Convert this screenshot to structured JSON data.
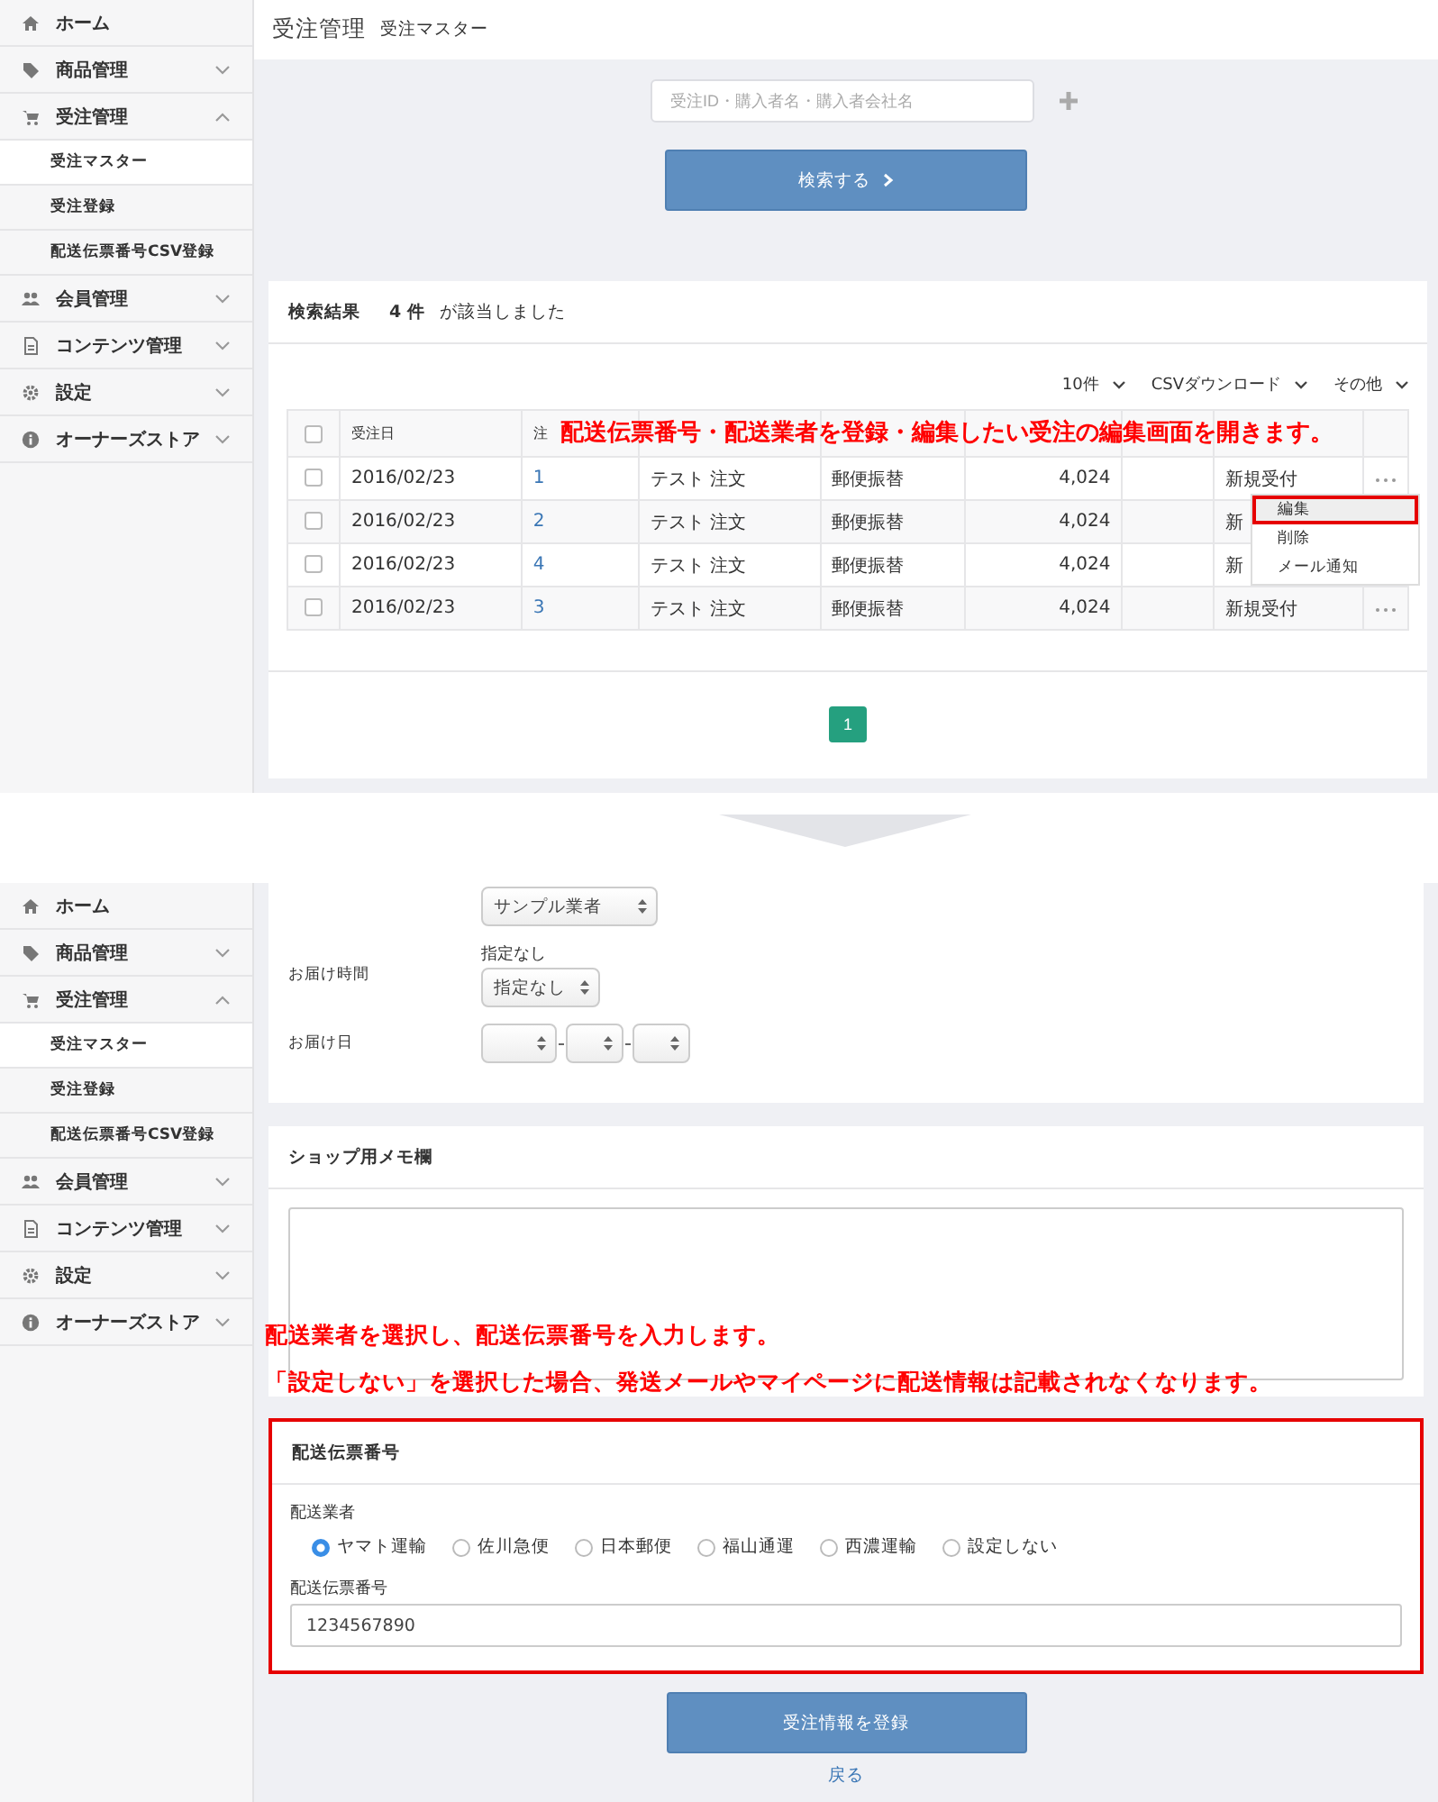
{
  "top": {
    "sidebar": [
      {
        "kind": "home",
        "label": "ホーム"
      },
      {
        "kind": "tag",
        "label": "商品管理",
        "expanded": false
      },
      {
        "kind": "cart",
        "label": "受注管理",
        "expanded": true,
        "children": [
          {
            "label": "受注マスター",
            "selected": true
          },
          {
            "label": "受注登録",
            "selected": false
          },
          {
            "label": "配送伝票番号CSV登録",
            "selected": false
          }
        ]
      },
      {
        "kind": "users",
        "label": "会員管理",
        "expanded": false
      },
      {
        "kind": "file",
        "label": "コンテンツ管理",
        "expanded": false
      },
      {
        "kind": "gear",
        "label": "設定",
        "expanded": false
      },
      {
        "kind": "info",
        "label": "オーナーズストア",
        "expanded": false
      }
    ],
    "header": {
      "title": "受注管理",
      "subtitle": "受注マスター"
    },
    "search": {
      "placeholder": "受注ID・購入者名・購入者会社名",
      "button": "検索する"
    },
    "results": {
      "title": "検索結果",
      "count": "4 件",
      "suffix": "が該当しました",
      "controls": [
        "10件",
        "CSVダウンロード",
        "その他"
      ],
      "all_checked": false,
      "columns": [
        "受注日",
        "注"
      ],
      "rows": [
        {
          "checked": false,
          "date": "2016/02/23",
          "number": "1",
          "name": "テスト 注文",
          "payment": "郵便振替",
          "amount": "4,024",
          "status": "新規受付"
        },
        {
          "checked": false,
          "date": "2016/02/23",
          "number": "2",
          "name": "テスト 注文",
          "payment": "郵便振替",
          "amount": "4,024",
          "status": "新"
        },
        {
          "checked": false,
          "date": "2016/02/23",
          "number": "4",
          "name": "テスト 注文",
          "payment": "郵便振替",
          "amount": "4,024",
          "status": "新"
        },
        {
          "checked": false,
          "date": "2016/02/23",
          "number": "3",
          "name": "テスト 注文",
          "payment": "郵便振替",
          "amount": "4,024",
          "status": "新規受付"
        }
      ],
      "menu": [
        {
          "label": "編集",
          "selected": true
        },
        {
          "label": "削除",
          "selected": false
        },
        {
          "label": "メール通知",
          "selected": false
        }
      ],
      "pages": [
        {
          "label": "1",
          "selected": true
        }
      ]
    },
    "annotation": "配送伝票番号・配送業者を登録・編集したい受注の編集画面を開きます。"
  },
  "bottom": {
    "sidebar": [
      {
        "kind": "home",
        "label": "ホーム"
      },
      {
        "kind": "tag",
        "label": "商品管理",
        "expanded": false
      },
      {
        "kind": "cart",
        "label": "受注管理",
        "expanded": true,
        "children": [
          {
            "label": "受注マスター",
            "selected": true
          },
          {
            "label": "受注登録",
            "selected": false
          },
          {
            "label": "配送伝票番号CSV登録",
            "selected": false
          }
        ]
      },
      {
        "kind": "users",
        "label": "会員管理",
        "expanded": false
      },
      {
        "kind": "file",
        "label": "コンテンツ管理",
        "expanded": false
      },
      {
        "kind": "gear",
        "label": "設定",
        "expanded": false
      },
      {
        "kind": "info",
        "label": "オーナーズストア",
        "expanded": false
      }
    ],
    "delivery": [
      {
        "kind": "select",
        "value": "サンプル業者"
      },
      {
        "kind": "select",
        "label": "お届け時間",
        "note": "指定なし",
        "value": "指定なし"
      },
      {
        "kind": "date",
        "label": "お届け日"
      }
    ],
    "memo": {
      "title": "ショップ用メモ欄"
    },
    "annotations": [
      "配送業者を選択し、配送伝票番号を入力します。",
      "「設定しない」を選択した場合、発送メールやマイページに配送情報は記載されなくなります。"
    ],
    "shipping": {
      "title": "配送伝票番号",
      "carrier_label": "配送業者",
      "carriers": [
        {
          "label": "ヤマト運輸",
          "selected": true
        },
        {
          "label": "佐川急便",
          "selected": false
        },
        {
          "label": "日本郵便",
          "selected": false
        },
        {
          "label": "福山通運",
          "selected": false
        },
        {
          "label": "西濃運輸",
          "selected": false
        },
        {
          "label": "設定しない",
          "selected": false
        }
      ],
      "number_label": "配送伝票番号",
      "number": "1234567890"
    },
    "submit": "受注情報を登録",
    "back": "戻る"
  }
}
